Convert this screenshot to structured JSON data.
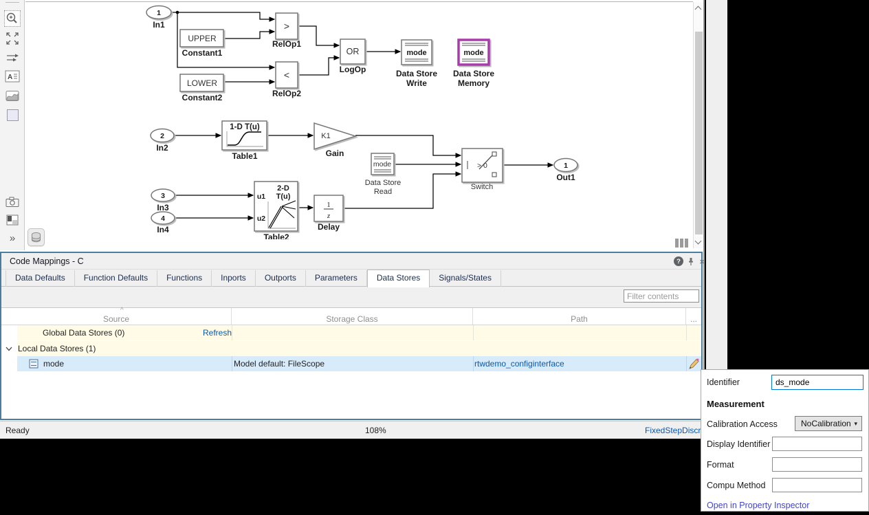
{
  "toolbar_left": {
    "icons": [
      "zoom-in",
      "fit-to-view",
      "signal-arrows",
      "annotation",
      "scope-wave",
      "shape-square",
      "screenshot-camera",
      "panel-layout",
      "more-chevrons"
    ],
    "annotation_glyph": "A",
    "more_glyph": "»"
  },
  "diagram": {
    "in1": {
      "num": "1",
      "label": "In1"
    },
    "in2": {
      "num": "2",
      "label": "In2"
    },
    "in3": {
      "num": "3",
      "label": "In3"
    },
    "in4": {
      "num": "4",
      "label": "In4"
    },
    "out1": {
      "num": "1",
      "label": "Out1"
    },
    "constant1": {
      "value": "UPPER",
      "label": "Constant1"
    },
    "constant2": {
      "value": "LOWER",
      "label": "Constant2"
    },
    "relop1": {
      "op": ">",
      "label": "RelOp1"
    },
    "relop2": {
      "op": "<",
      "label": "RelOp2"
    },
    "logop": {
      "op": "OR",
      "label": "LogOp"
    },
    "data_store_write": {
      "value": "mode",
      "label_line1": "Data Store",
      "label_line2": "Write"
    },
    "data_store_memory": {
      "value": "mode",
      "label_line1": "Data Store",
      "label_line2": "Memory"
    },
    "data_store_read": {
      "value": "mode",
      "label_line1": "Data Store",
      "label_line2": "Read"
    },
    "table1": {
      "title": "1-D T(u)",
      "label": "Table1"
    },
    "table2": {
      "dim": "2-D",
      "fn": "T(u)",
      "in1": "u1",
      "in2": "u2",
      "label": "Table2"
    },
    "gain": {
      "value": "K1",
      "label": "Gain"
    },
    "switch_block": {
      "criteria": "> 0",
      "label": "Switch"
    },
    "delay": {
      "num": "1",
      "den": "z",
      "label": "Delay"
    }
  },
  "code_mappings": {
    "title": "Code Mappings - C",
    "icons": {
      "help": "?",
      "close": "×"
    },
    "tabs": [
      {
        "label": "Data Defaults"
      },
      {
        "label": "Function Defaults"
      },
      {
        "label": "Functions"
      },
      {
        "label": "Inports"
      },
      {
        "label": "Outports"
      },
      {
        "label": "Parameters"
      },
      {
        "label": "Data Stores",
        "active": true
      },
      {
        "label": "Signals/States"
      }
    ],
    "filter_placeholder": "Filter contents",
    "table": {
      "sort_indicator": "^",
      "columns": [
        "Source",
        "Storage Class",
        "Path",
        "..."
      ],
      "rows": [
        {
          "label": "Global Data Stores (0)",
          "action": "Refresh"
        },
        {
          "label": "Local Data Stores (1)",
          "expanded": true
        },
        {
          "name": "mode",
          "storage_class": "Model default: FileScope",
          "path": "rtwdemo_configinterface",
          "selected": true
        }
      ]
    }
  },
  "status_bar": {
    "left": "Ready",
    "zoom": "108%",
    "right": "FixedStepDiscre"
  },
  "property_panel": {
    "identifier_label": "Identifier",
    "identifier_value": "ds_mode",
    "section_title": "Measurement",
    "calibration_access_label": "Calibration Access",
    "calibration_access_value": "NoCalibration",
    "dropdown_caret": "▾",
    "display_identifier_label": "Display Identifier",
    "display_identifier_value": "",
    "format_label": "Format",
    "format_value": "",
    "compu_method_label": "Compu Method",
    "compu_method_value": "",
    "link_label": "Open in Property Inspector"
  },
  "colors": {
    "panel_border": "#4a7da0",
    "selection_purple": "#a93bad",
    "link_blue": "#0a58ad",
    "link_indigo": "#4245c9",
    "row_yellow": "#fffbe6",
    "row_selected_blue": "#d7ebfa",
    "focus_blue": "#0078d7"
  }
}
